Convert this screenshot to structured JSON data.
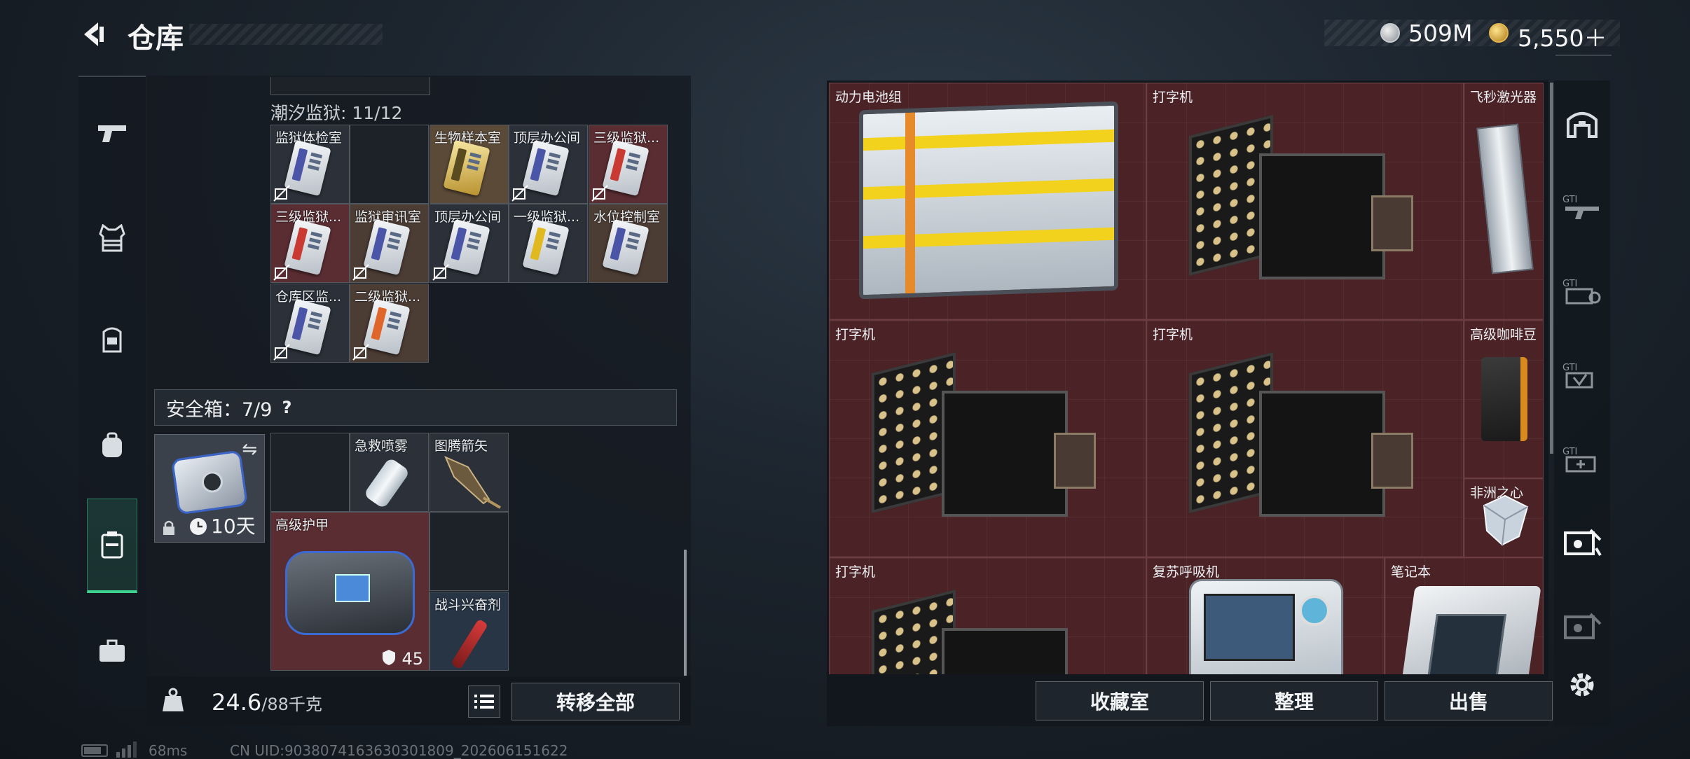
{
  "header": {
    "title": "仓库",
    "currency_silver": "509M",
    "currency_gold": "5,550＋"
  },
  "left_nav": {
    "icons": [
      "pistol-icon",
      "armor-vest-icon",
      "helmet-icon",
      "backpack-icon",
      "case-icon",
      "toolbox-icon"
    ]
  },
  "prison": {
    "header": "潮汐监狱: 11/12",
    "cards": [
      {
        "label": "监狱体检室"
      },
      {
        "label": ""
      },
      {
        "label": "生物样本室"
      },
      {
        "label": "顶层办公间"
      },
      {
        "label": "三级监狱..."
      },
      {
        "label": "三级监狱..."
      },
      {
        "label": "监狱审讯室"
      },
      {
        "label": "顶层办公间"
      },
      {
        "label": "一级监狱..."
      },
      {
        "label": "水位控制室"
      },
      {
        "label": "仓库区监..."
      },
      {
        "label": "二级监狱..."
      }
    ]
  },
  "safebox": {
    "title": "安全箱：7/9",
    "help": "?",
    "timer": "10天"
  },
  "case_items": {
    "spray": "急救喷雾",
    "arrow": "图腾箭矢",
    "armor": "高级护甲",
    "armor_durability": "45",
    "stim": "战斗兴奋剂"
  },
  "footer": {
    "weight_value": "24.6",
    "weight_max": "/88千克",
    "transfer_all": "转移全部"
  },
  "stash": {
    "items": [
      {
        "label": "动力电池组"
      },
      {
        "label": "打字机"
      },
      {
        "label": "飞秒激光器"
      },
      {
        "label": "打字机"
      },
      {
        "label": "打字机"
      },
      {
        "label": "高级咖啡豆"
      },
      {
        "label": "非洲之心"
      },
      {
        "label": "打字机"
      },
      {
        "label": "复苏呼吸机"
      },
      {
        "label": "笔记本"
      }
    ]
  },
  "actions": {
    "collection": "收藏室",
    "organize": "整理",
    "sell": "出售"
  },
  "status": {
    "ping": "68ms",
    "uid": "CN UID:9038074163630301809_202606151622"
  },
  "colors": {
    "accent_green": "#3ecf8e",
    "stash_red": "#4b2226",
    "panel": "#151b22"
  }
}
